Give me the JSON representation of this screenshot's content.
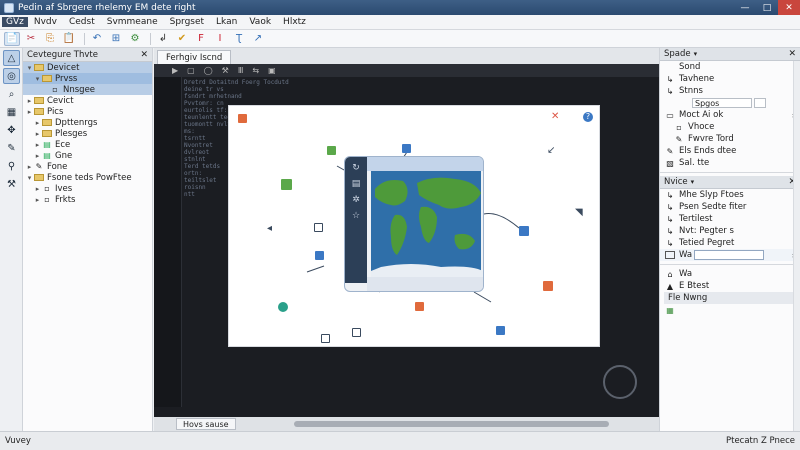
{
  "window": {
    "title": "Pedin af Sbrgere rhelemy EM dete right",
    "controls": {
      "minimize": "—",
      "maximize": "□",
      "close": "✕"
    }
  },
  "menu": [
    "GVz",
    "Nvdv",
    "Cedst",
    "Svmmeane",
    "Sprgset",
    "Lkan",
    "Vaok",
    "Hlxtz"
  ],
  "toolbar": {
    "icons": [
      "new-file-icon",
      "cut-icon",
      "copy-icon",
      "paste-icon",
      "undo-icon",
      "open-icon",
      "tools-icon",
      "edit-icon",
      "check-icon",
      "align-icon",
      "format-icon",
      "text-icon",
      "run-icon"
    ]
  },
  "toolstrip": {
    "icons": [
      "select-icon",
      "target-icon",
      "search-icon",
      "frame-icon",
      "move-icon",
      "pen-icon",
      "pin-icon",
      "wrench-icon"
    ]
  },
  "left_panel": {
    "title": "Cevtegure Thvte",
    "close": "✕",
    "tree": [
      {
        "label": "Devicet",
        "level": 0,
        "icon": "folder",
        "state": "sel"
      },
      {
        "label": "Prvss",
        "level": 1,
        "icon": "folder",
        "state": "sel2"
      },
      {
        "label": "Nnsgee",
        "level": 2,
        "icon": "file",
        "state": "sel"
      },
      {
        "label": "Cevict",
        "level": 0,
        "icon": "folder",
        "state": ""
      },
      {
        "label": "Pics",
        "level": 0,
        "icon": "folder",
        "state": ""
      },
      {
        "label": "Dpttenrgs",
        "level": 1,
        "icon": "folder",
        "state": ""
      },
      {
        "label": "Plesges",
        "level": 1,
        "icon": "folder",
        "state": ""
      },
      {
        "label": "Ece",
        "level": 1,
        "icon": "doc",
        "state": ""
      },
      {
        "label": "Gne",
        "level": 1,
        "icon": "doc",
        "state": ""
      },
      {
        "label": "Fone",
        "level": 0,
        "icon": "pen",
        "state": ""
      },
      {
        "label": "Fsone teds PowFtee",
        "level": 0,
        "icon": "folder",
        "state": ""
      },
      {
        "label": "Ives",
        "level": 1,
        "icon": "file",
        "state": ""
      },
      {
        "label": "Frkts",
        "level": 1,
        "icon": "file",
        "state": ""
      }
    ]
  },
  "editor": {
    "tab": "Ferhgiv Iscnd",
    "toolbar_marks": [
      "▶",
      "▢",
      "◯",
      "⚒",
      "Ⅲ",
      "⇆",
      "▣"
    ],
    "code_lines": [
      "  Dretrd Dotaitnd Foerg Tocdutd",
      "  deine tr vs",
      "  fsndrt mrhetnand",
      "  Pvvtomr: cn",
      "  eurtolis tf:",
      "  teunlentt tedelnr:",
      "  tuomontt nvltds",
      "    ms:",
      "    tsrntt",
      "    Nvontret",
      "      dvlreot",
      "      stnlnt",
      "    Terd tetds",
      "      ortn:",
      "      teiltslet",
      "      roisnn",
      "      ntt"
    ],
    "bottom_tab": "Hovs sause"
  },
  "right_panel": {
    "section1": {
      "title": "Spade",
      "rows": [
        {
          "label": "Sond",
          "indent": false,
          "icon": ""
        },
        {
          "label": "Tavhene",
          "indent": false,
          "icon": "↳"
        },
        {
          "label": "Stnns",
          "indent": false,
          "icon": "↳"
        },
        {
          "label": "Spgos",
          "indent": true,
          "icon": "",
          "input": true
        },
        {
          "label": "Moct Ai ok",
          "indent": false,
          "icon": "▭",
          "arrow": true
        },
        {
          "label": "Vhoce",
          "indent": true,
          "icon": "▫"
        },
        {
          "label": "Fwvre Tord",
          "indent": true,
          "icon": "✎"
        },
        {
          "label": "Els Ends dtee",
          "indent": false,
          "icon": "✎"
        },
        {
          "label": "Sal. tte",
          "indent": false,
          "icon": "▧"
        }
      ]
    },
    "section2": {
      "title": "Nvice",
      "rows": [
        {
          "label": "Mhe Slyp Ftoes",
          "icon": "↳"
        },
        {
          "label": "Psen Sedte fiter",
          "icon": "↳"
        },
        {
          "label": "Tertilest",
          "icon": "↳"
        },
        {
          "label": "Nvt: Pegter s",
          "icon": "↳"
        },
        {
          "label": "Tetied Pegret",
          "icon": "↳"
        }
      ],
      "input_label": "Wa",
      "rows2": [
        {
          "label": "Wa",
          "icon": "📎"
        },
        {
          "label": "E Btest",
          "icon": "▲"
        },
        {
          "label": "Fle Nwng",
          "icon": ""
        }
      ]
    }
  },
  "status": {
    "left": "Vuvey",
    "right": "Ptecatn Z Pnece"
  },
  "colors": {
    "title_bar": "#2b4a70",
    "accent": "#4f7fc0",
    "editor_bg": "#1b1d22",
    "map_water": "#2f6fa9",
    "map_land": "#4e9a3a"
  }
}
